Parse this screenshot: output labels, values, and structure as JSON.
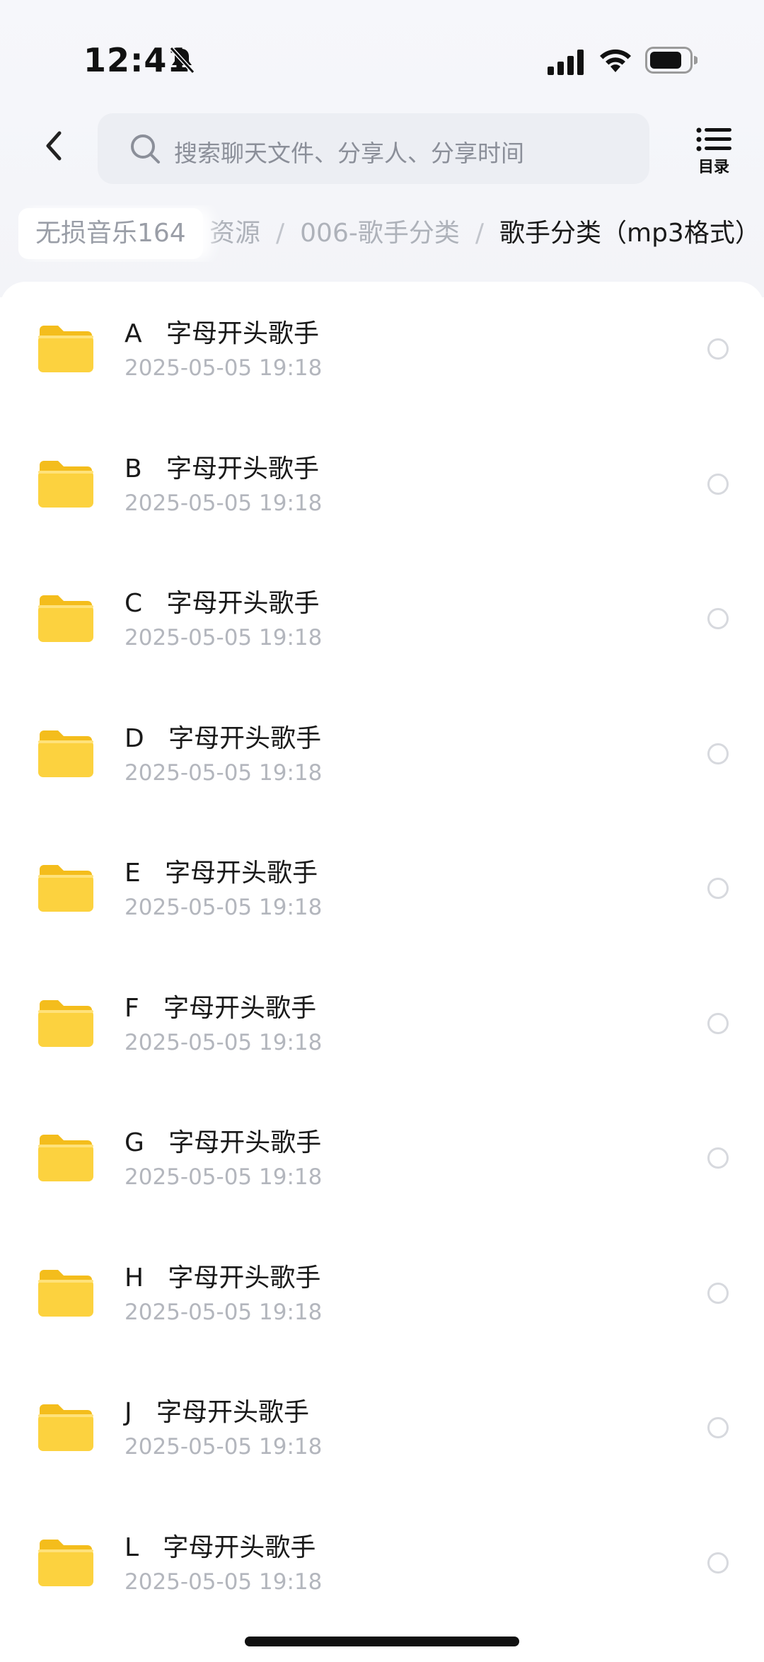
{
  "status_bar": {
    "time": "12:41"
  },
  "header": {
    "search_placeholder": "搜索聊天文件、分享人、分享时间",
    "toc_label": "目录"
  },
  "breadcrumb": {
    "root": "无损音乐164",
    "trail": [
      "资源",
      "006-歌手分类"
    ],
    "current": "歌手分类（mp3格式）",
    "separator": "/"
  },
  "colors": {
    "folder": "#fcd23f",
    "folder_dark": "#f4bd1c",
    "date_text": "#b3b6bd"
  },
  "items": [
    {
      "letter": "A",
      "name": "字母开头歌手",
      "date": "2025-05-05 19:18"
    },
    {
      "letter": "B",
      "name": "字母开头歌手",
      "date": "2025-05-05 19:18"
    },
    {
      "letter": "C",
      "name": "字母开头歌手",
      "date": "2025-05-05 19:18"
    },
    {
      "letter": "D",
      "name": "字母开头歌手",
      "date": "2025-05-05 19:18"
    },
    {
      "letter": "E",
      "name": "字母开头歌手",
      "date": "2025-05-05 19:18"
    },
    {
      "letter": "F",
      "name": "字母开头歌手",
      "date": "2025-05-05 19:18"
    },
    {
      "letter": "G",
      "name": "字母开头歌手",
      "date": "2025-05-05 19:18"
    },
    {
      "letter": "H",
      "name": "字母开头歌手",
      "date": "2025-05-05 19:18"
    },
    {
      "letter": "J",
      "name": "字母开头歌手",
      "date": "2025-05-05 19:18"
    },
    {
      "letter": "L",
      "name": "字母开头歌手",
      "date": "2025-05-05 19:18"
    }
  ]
}
